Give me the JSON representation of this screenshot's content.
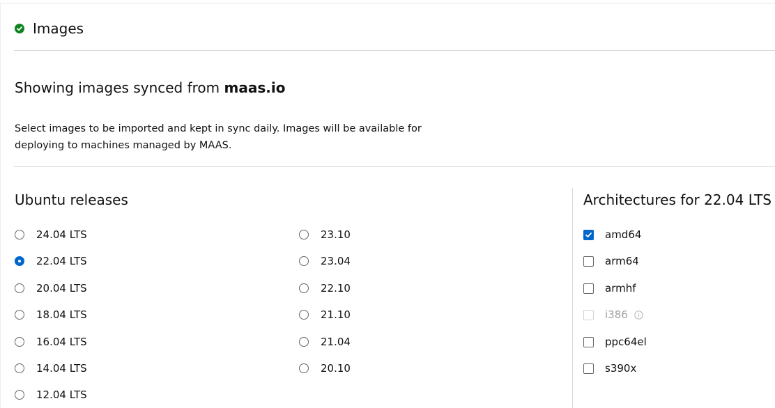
{
  "header": {
    "title": "Images",
    "status": "synced",
    "status_color": "#0e8420"
  },
  "source": {
    "prefix": "Showing images synced from",
    "host": "maas.io"
  },
  "description": "Select images to be imported and kept in sync daily. Images will be available for deploying to machines managed by MAAS.",
  "releases": {
    "title": "Ubuntu releases",
    "selected": "22.04 LTS",
    "column1": [
      "24.04 LTS",
      "22.04 LTS",
      "20.04 LTS",
      "18.04 LTS",
      "16.04 LTS",
      "14.04 LTS",
      "12.04 LTS"
    ],
    "column2": [
      "23.10",
      "23.04",
      "22.10",
      "21.10",
      "21.04",
      "20.10"
    ]
  },
  "architectures": {
    "title": "Architectures for 22.04 LTS",
    "items": [
      {
        "label": "amd64",
        "checked": true,
        "disabled": false
      },
      {
        "label": "arm64",
        "checked": false,
        "disabled": false
      },
      {
        "label": "armhf",
        "checked": false,
        "disabled": false
      },
      {
        "label": "i386",
        "checked": false,
        "disabled": true,
        "info": true
      },
      {
        "label": "ppc64el",
        "checked": false,
        "disabled": false
      },
      {
        "label": "s390x",
        "checked": false,
        "disabled": false
      }
    ]
  },
  "colors": {
    "accent": "#0066cc",
    "success": "#0e8420"
  }
}
